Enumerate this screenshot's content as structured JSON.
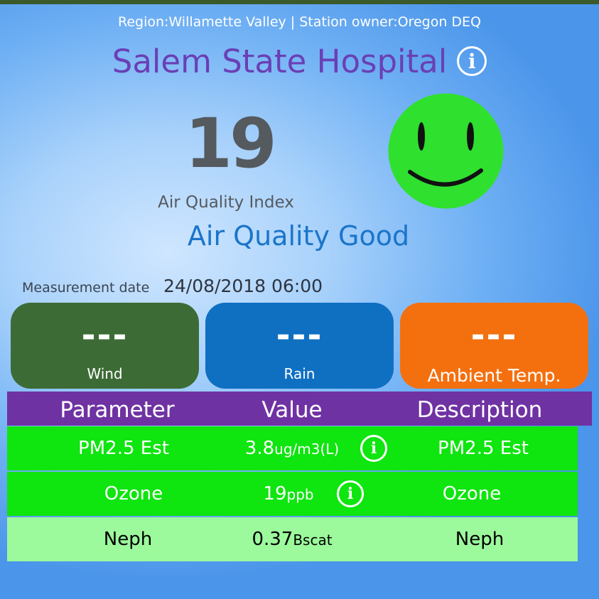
{
  "header": {
    "region_line": "Region:Willamette Valley | Station owner:Oregon DEQ",
    "station_name": "Salem State Hospital",
    "info_glyph": "i"
  },
  "aqi": {
    "value": "19",
    "label": "Air Quality Index",
    "status": "Air Quality Good",
    "face_icon": "smiley-face-icon",
    "face_color": "#2fe02f"
  },
  "measurement": {
    "label": "Measurement date",
    "value": "24/08/2018 06:00"
  },
  "cards": {
    "wind": {
      "value": "---",
      "label": "Wind",
      "color": "#3d6b35"
    },
    "rain": {
      "value": "---",
      "label": "Rain",
      "color": "#0f70c2"
    },
    "temp": {
      "value": "---",
      "label": "Ambient Temp.",
      "color": "#f4700f"
    }
  },
  "table": {
    "header_color": "#6f32a3",
    "headers": [
      "Parameter",
      "Value",
      "Description"
    ],
    "rows": [
      {
        "parameter": "PM2.5 Est",
        "value": "3.8",
        "unit": "ug/m3(L)",
        "description": "PM2.5 Est",
        "row_color": "#0fe50f"
      },
      {
        "parameter": "Ozone",
        "value": "19",
        "unit": "ppb",
        "description": "Ozone",
        "row_color": "#0fe50f"
      },
      {
        "parameter": "Neph",
        "value": "0.37",
        "unit": "Bscat",
        "description": "Neph",
        "row_color": "#9cf99c"
      }
    ]
  }
}
